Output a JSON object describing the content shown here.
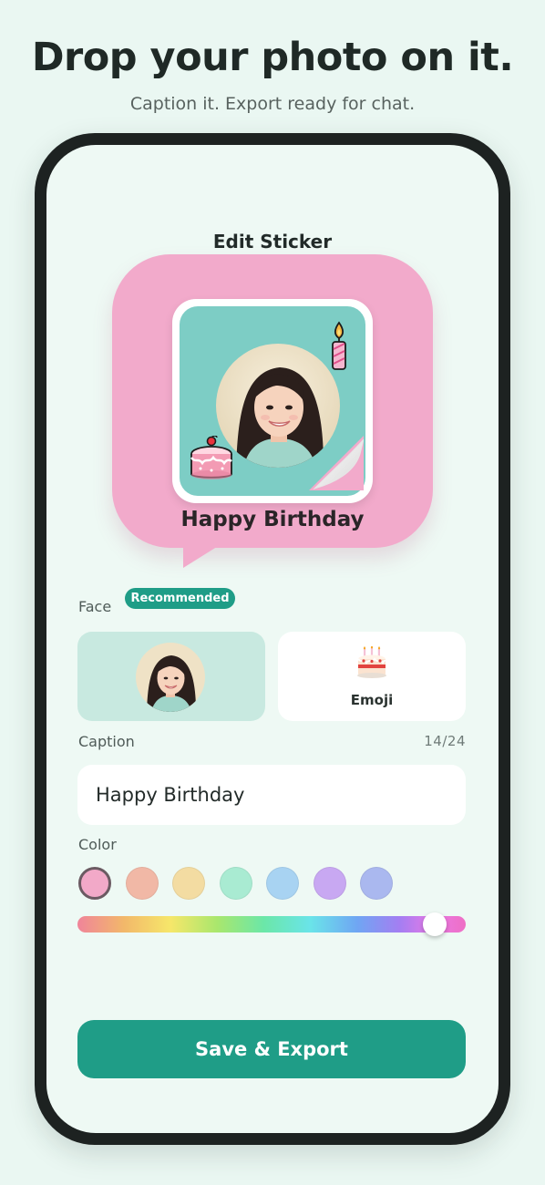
{
  "hero": {
    "title": "Drop your photo on it.",
    "subtitle": "Caption it. Export ready for chat."
  },
  "editor": {
    "title": "Edit Sticker",
    "preview": {
      "caption": "Happy Birthday",
      "icons": [
        "candle-icon",
        "cake-icon",
        "page-curl-icon"
      ]
    },
    "face": {
      "label": "Face",
      "badge": "Recommended",
      "options": [
        {
          "type": "face-photo",
          "selected": true
        },
        {
          "type": "emoji",
          "label": "Emoji",
          "icon": "cake-emoji-icon"
        }
      ]
    },
    "caption": {
      "label": "Caption",
      "count": "14/24",
      "value": "Happy Birthday"
    },
    "color": {
      "label": "Color",
      "swatches": [
        "#f2a9c8",
        "#f1b8a6",
        "#f3dca2",
        "#a9ebd2",
        "#a8d3f2",
        "#c8a8f2",
        "#aab8ef"
      ],
      "selected_index": 0,
      "hue_value": 0.92
    },
    "save_label": "Save & Export"
  },
  "colors": {
    "accent": "#1f9d87",
    "bubble": "#f2aacb",
    "sticker_bg": "#7dcdc5",
    "page_bg": "#eaf7f2"
  }
}
